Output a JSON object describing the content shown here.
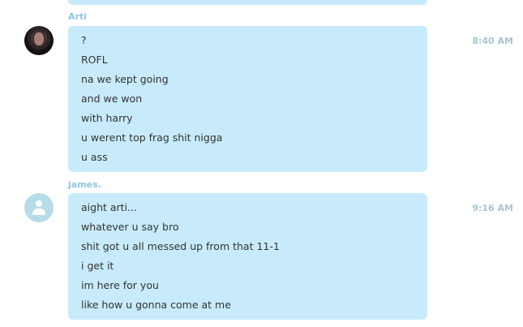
{
  "conversation": {
    "groups": [
      {
        "sender": "Arti",
        "time": "8:40 AM",
        "avatar": "user-photo",
        "messages": [
          "?",
          "ROFL",
          "na we kept going",
          "and we won",
          "with harry",
          "u werent top frag shit nigga",
          "u ass"
        ]
      },
      {
        "sender": "james.",
        "time": "9:16 AM",
        "avatar": "default-user-icon",
        "messages": [
          "aight arti...",
          "whatever u say bro",
          "shit got u all messed up from that 11-1",
          "i get it",
          "im here for you",
          "like how u gonna come at me"
        ]
      }
    ]
  },
  "colors": {
    "bubble": "#c7ebfb",
    "sender_name": "#8fc6e2",
    "timestamp": "#a7c4d4",
    "message_text": "#333333"
  }
}
